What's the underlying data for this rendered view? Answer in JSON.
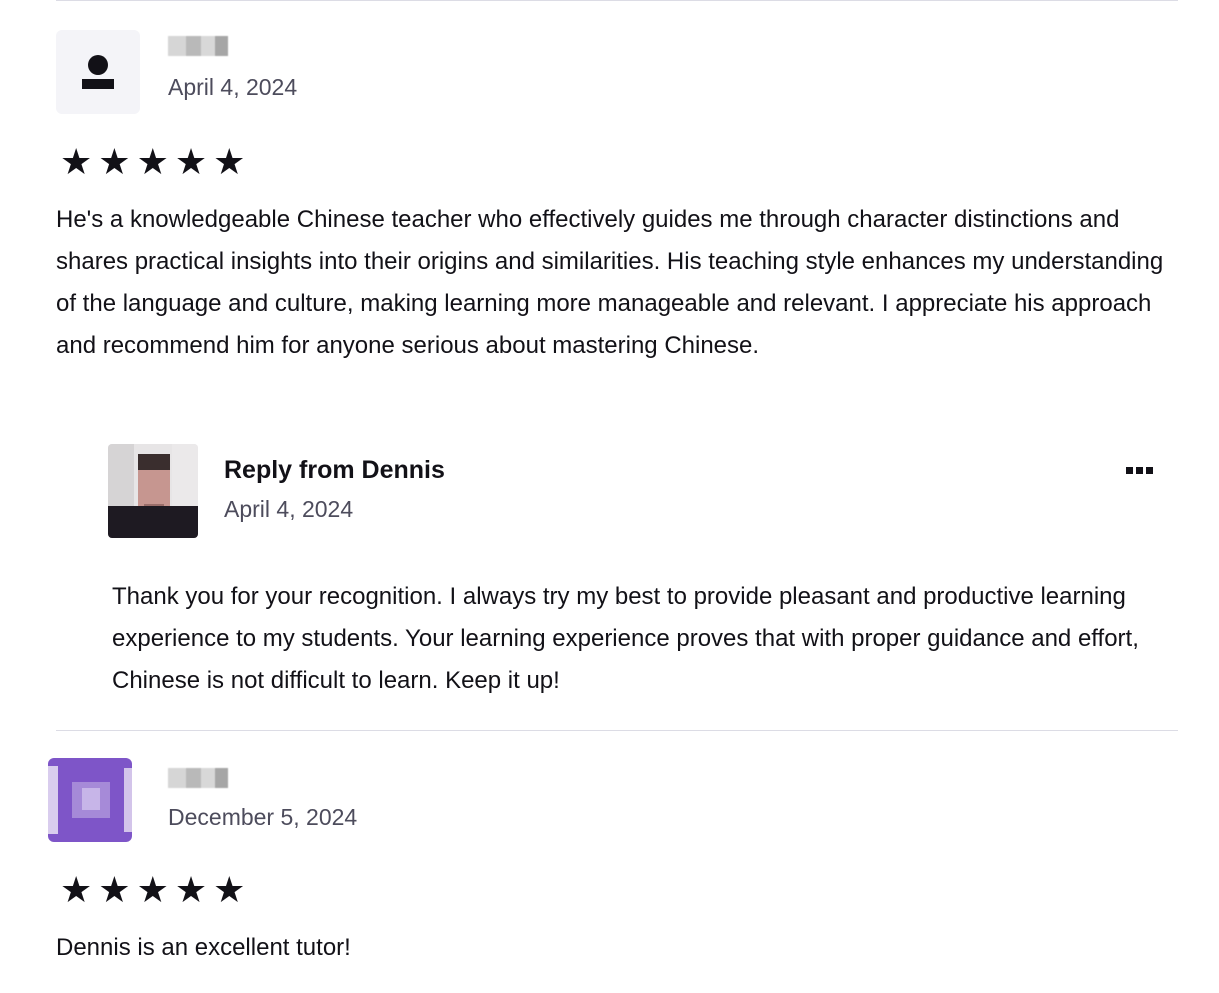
{
  "reviews": [
    {
      "author_name": "",
      "date": "April 4, 2024",
      "rating": 5,
      "stars": [
        "★",
        "★",
        "★",
        "★",
        "★"
      ],
      "text": "He's a knowledgeable Chinese teacher who effectively guides me through character distinctions and shares practical insights into their origins and similarities. His teaching style enhances my understanding of the language and culture, making learning more manageable and relevant. I appreciate his approach and recommend him for anyone serious about mastering Chinese.",
      "reply": {
        "title": "Reply from Dennis",
        "date": "April 4, 2024",
        "text": "Thank you for your recognition. I always try my best to provide pleasant and productive learning experience to my students. Your learning experience proves that with proper guidance and effort, Chinese is not difficult to learn. Keep it up!",
        "more_icon": "more-horizontal-icon"
      }
    },
    {
      "author_name": "",
      "date": "December 5, 2024",
      "rating": 5,
      "stars": [
        "★",
        "★",
        "★",
        "★",
        "★"
      ],
      "text": "Dennis is an excellent tutor!"
    }
  ],
  "icons": {
    "default_avatar": "person-icon",
    "star": "star-icon"
  },
  "colors": {
    "text": "#121117",
    "muted_text": "#4d4c5c",
    "divider": "#dcdce5",
    "avatar_bg": "#f4f4f8",
    "purple_avatar": "#7e55c8"
  }
}
